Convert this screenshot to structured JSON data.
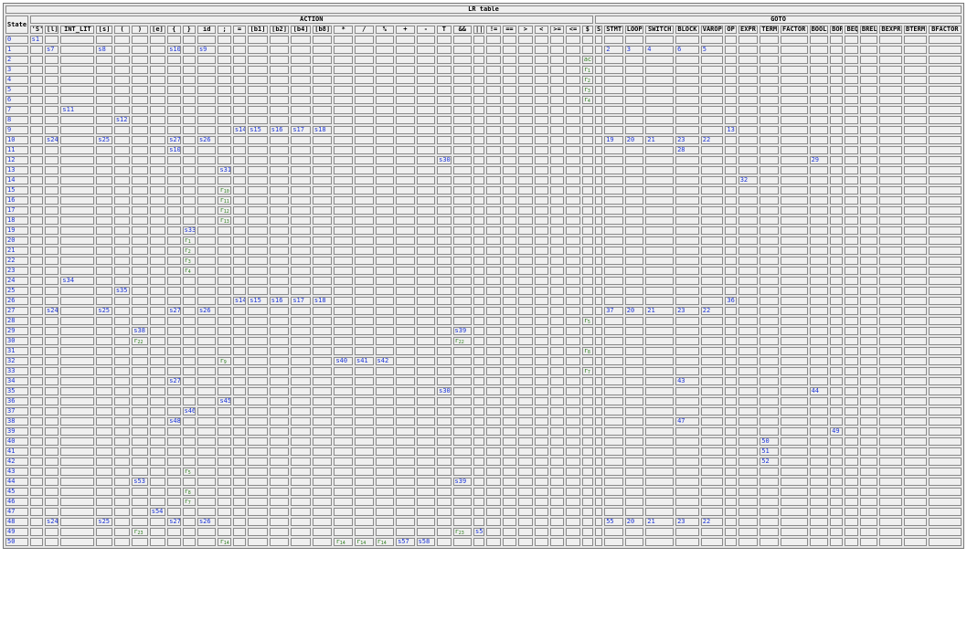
{
  "title": "LR table",
  "state_header": "State",
  "action_header": "ACTION",
  "goto_header": "GOTO",
  "action_columns": [
    "'S'",
    "[l]",
    "INT_LIT",
    "[s]",
    "(",
    ")",
    "[e]",
    "{",
    "}",
    "id",
    ";",
    "=",
    "[b1]",
    "[b2]",
    "[b4]",
    "[b8]",
    "*",
    "/",
    "%",
    "+",
    "-",
    "T",
    "&&",
    "||",
    "!=",
    "==",
    ">",
    "<",
    ">=",
    "<=",
    "$"
  ],
  "goto_columns": [
    "S",
    "STMT",
    "LOOP",
    "SWITCH",
    "BLOCK",
    "VAROP",
    "OP",
    "EXPR",
    "TERM",
    "FACTOR",
    "BOOL",
    "BOR",
    "BEQ",
    "BREL",
    "BEXPR",
    "BTERM",
    "BFACTOR"
  ],
  "rows": [
    {
      "state": "0",
      "action": {
        "'S'": "s1"
      },
      "goto": {}
    },
    {
      "state": "1",
      "action": {
        "[l]": "s7",
        "[s]": "s8",
        "{": "s10",
        "id": "s9"
      },
      "goto": {
        "STMT": "2",
        "LOOP": "3",
        "SWITCH": "4",
        "BLOCK": "6",
        "VAROP": "5"
      }
    },
    {
      "state": "2",
      "action": {
        "$": "acc"
      },
      "goto": {}
    },
    {
      "state": "3",
      "action": {
        "$": "r1"
      },
      "goto": {}
    },
    {
      "state": "4",
      "action": {
        "$": "r2"
      },
      "goto": {}
    },
    {
      "state": "5",
      "action": {
        "$": "r3"
      },
      "goto": {}
    },
    {
      "state": "6",
      "action": {
        "$": "r4"
      },
      "goto": {}
    },
    {
      "state": "7",
      "action": {
        "INT_LIT": "s11"
      },
      "goto": {}
    },
    {
      "state": "8",
      "action": {
        "(": "s12"
      },
      "goto": {}
    },
    {
      "state": "9",
      "action": {
        "=": "s14",
        "[b1]": "s15",
        "[b2]": "s16",
        "[b4]": "s17",
        "[b8]": "s18"
      },
      "goto": {
        "OP": "13"
      }
    },
    {
      "state": "10",
      "action": {
        "[l]": "s24",
        "[s]": "s25",
        "{": "s27",
        "id": "s26"
      },
      "goto": {
        "STMT": "19",
        "LOOP": "20",
        "SWITCH": "21",
        "BLOCK": "23",
        "VAROP": "22"
      }
    },
    {
      "state": "11",
      "action": {
        "{": "s10"
      },
      "goto": {
        "BLOCK": "28"
      }
    },
    {
      "state": "12",
      "action": {
        "T": "s30"
      },
      "goto": {
        "BOOL": "29"
      }
    },
    {
      "state": "13",
      "action": {
        ";": "s31"
      },
      "goto": {}
    },
    {
      "state": "14",
      "action": {},
      "goto": {
        "EXPR": "32"
      }
    },
    {
      "state": "15",
      "action": {
        ";": "r10"
      },
      "goto": {}
    },
    {
      "state": "16",
      "action": {
        ";": "r11"
      },
      "goto": {}
    },
    {
      "state": "17",
      "action": {
        ";": "r12"
      },
      "goto": {}
    },
    {
      "state": "18",
      "action": {
        ";": "r13"
      },
      "goto": {}
    },
    {
      "state": "19",
      "action": {
        "}": "s33"
      },
      "goto": {}
    },
    {
      "state": "20",
      "action": {
        "}": "r1"
      },
      "goto": {}
    },
    {
      "state": "21",
      "action": {
        "}": "r2"
      },
      "goto": {}
    },
    {
      "state": "22",
      "action": {
        "}": "r3"
      },
      "goto": {}
    },
    {
      "state": "23",
      "action": {
        "}": "r4"
      },
      "goto": {}
    },
    {
      "state": "24",
      "action": {
        "INT_LIT": "s34"
      },
      "goto": {}
    },
    {
      "state": "25",
      "action": {
        "(": "s35"
      },
      "goto": {}
    },
    {
      "state": "26",
      "action": {
        "=": "s14",
        "[b1]": "s15",
        "[b2]": "s16",
        "[b4]": "s17",
        "[b8]": "s18"
      },
      "goto": {
        "OP": "36"
      }
    },
    {
      "state": "27",
      "action": {
        "[l]": "s24",
        "[s]": "s25",
        "{": "s27",
        "id": "s26"
      },
      "goto": {
        "STMT": "37",
        "LOOP": "20",
        "SWITCH": "21",
        "BLOCK": "23",
        "VAROP": "22"
      }
    },
    {
      "state": "28",
      "action": {
        "$": "r5"
      },
      "goto": {}
    },
    {
      "state": "29",
      "action": {
        ")": "s38",
        "&&": "s39"
      },
      "goto": {}
    },
    {
      "state": "30",
      "action": {
        ")": "r22",
        "&&": "r22"
      },
      "goto": {}
    },
    {
      "state": "31",
      "action": {
        "$": "r8"
      },
      "goto": {}
    },
    {
      "state": "32",
      "action": {
        ";": "r9",
        "*": "s40",
        "/": "s41",
        "%": "s42"
      },
      "goto": {}
    },
    {
      "state": "33",
      "action": {
        "$": "r7"
      },
      "goto": {}
    },
    {
      "state": "34",
      "action": {
        "{": "s27"
      },
      "goto": {
        "BLOCK": "43"
      }
    },
    {
      "state": "35",
      "action": {
        "T": "s30"
      },
      "goto": {
        "BOOL": "44"
      }
    },
    {
      "state": "36",
      "action": {
        ";": "s45"
      },
      "goto": {}
    },
    {
      "state": "37",
      "action": {
        "}": "s46"
      },
      "goto": {}
    },
    {
      "state": "38",
      "action": {
        "{": "s48"
      },
      "goto": {
        "BLOCK": "47"
      }
    },
    {
      "state": "39",
      "action": {},
      "goto": {
        "BOR": "49"
      }
    },
    {
      "state": "40",
      "action": {},
      "goto": {
        "TERM": "50"
      }
    },
    {
      "state": "41",
      "action": {},
      "goto": {
        "TERM": "51"
      }
    },
    {
      "state": "42",
      "action": {},
      "goto": {
        "TERM": "52"
      }
    },
    {
      "state": "43",
      "action": {
        "}": "r5"
      },
      "goto": {}
    },
    {
      "state": "44",
      "action": {
        ")": "s53",
        "&&": "s39"
      },
      "goto": {}
    },
    {
      "state": "45",
      "action": {
        "}": "r8"
      },
      "goto": {}
    },
    {
      "state": "46",
      "action": {
        "}": "r7"
      },
      "goto": {}
    },
    {
      "state": "47",
      "action": {
        "[e]": "s54"
      },
      "goto": {}
    },
    {
      "state": "48",
      "action": {
        "[l]": "s24",
        "[s]": "s25",
        "{": "s27",
        "id": "s26"
      },
      "goto": {
        "STMT": "55",
        "LOOP": "20",
        "SWITCH": "21",
        "BLOCK": "23",
        "VAROP": "22"
      }
    },
    {
      "state": "49",
      "action": {
        ")": "r23",
        "&&": "r23",
        "||": "s56"
      },
      "goto": {}
    },
    {
      "state": "50",
      "action": {
        ";": "r14",
        "*": "r14",
        "/": "r14",
        "%": "r14",
        "+": "s57",
        "-": "s58"
      },
      "goto": {}
    }
  ]
}
